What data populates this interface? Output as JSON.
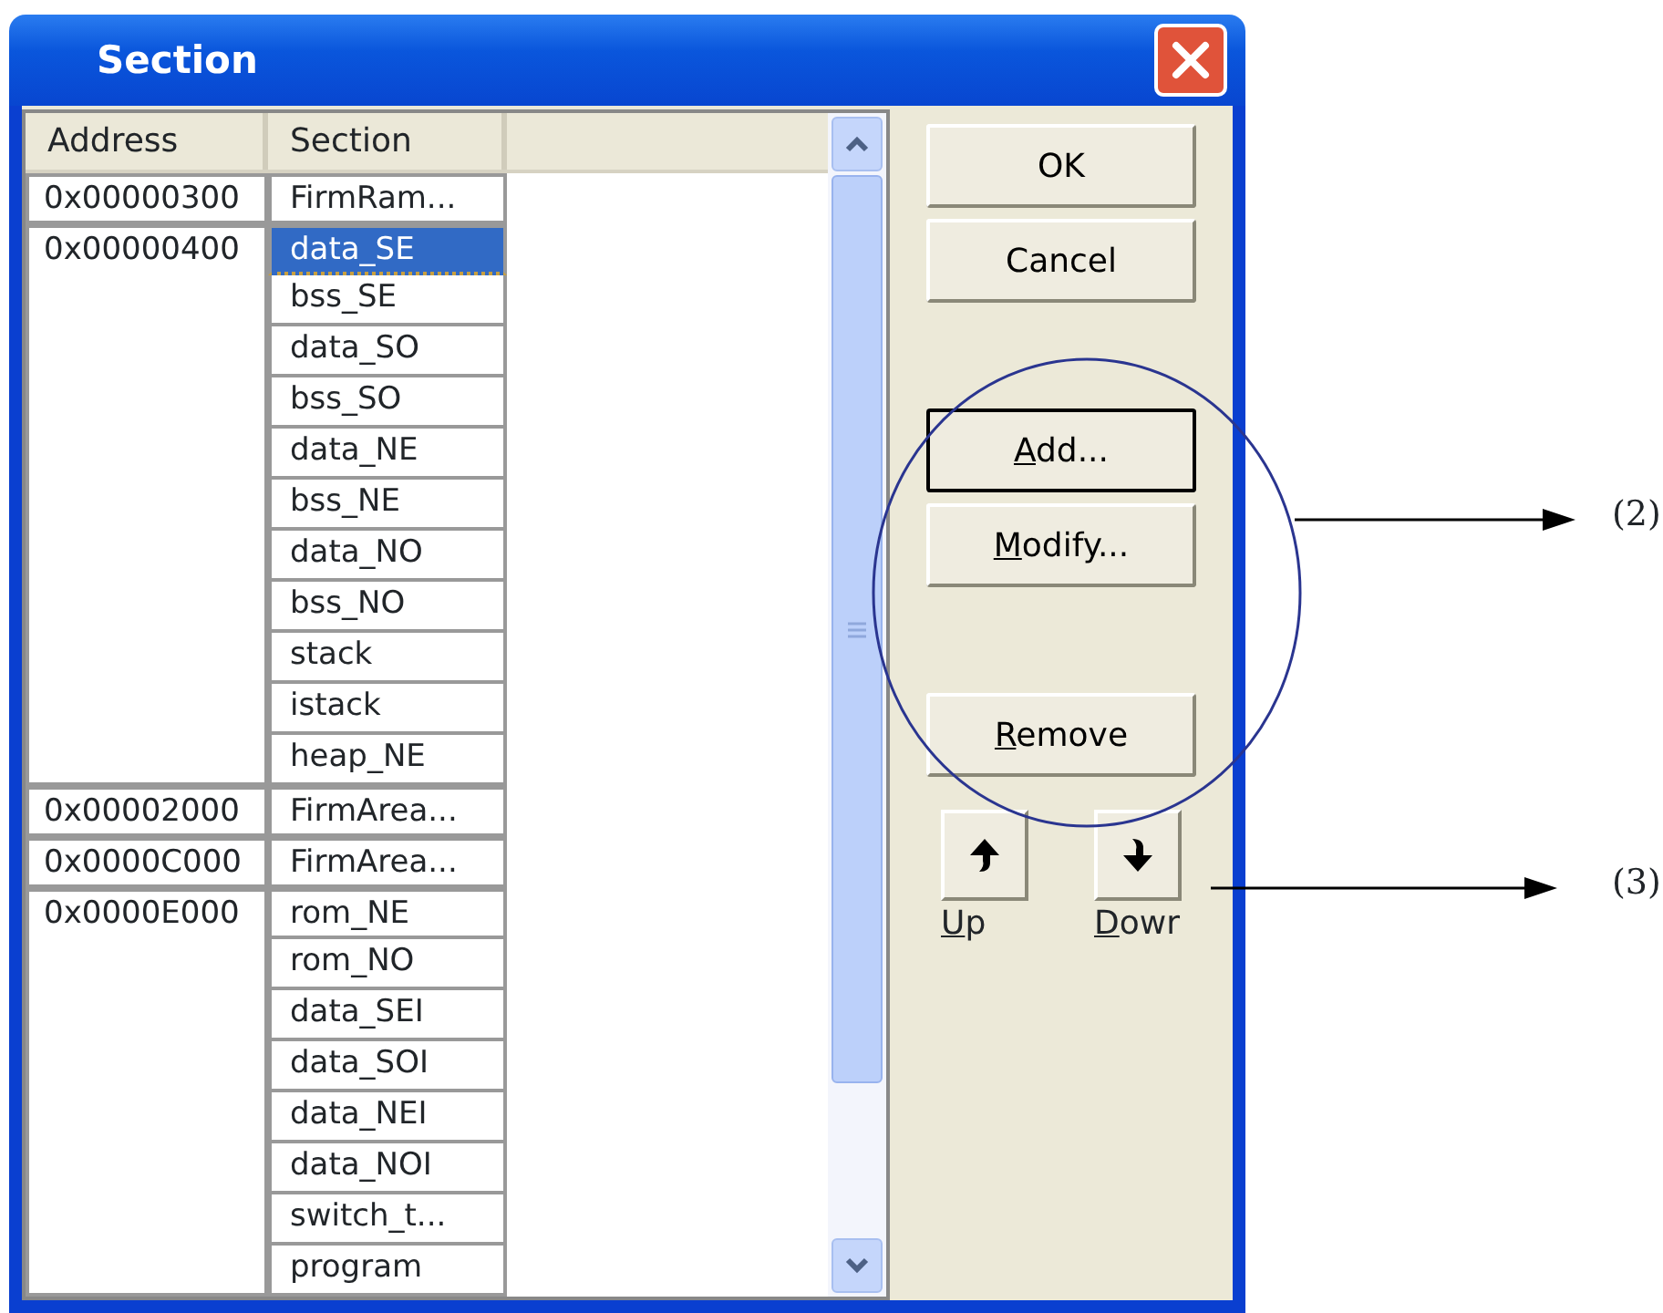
{
  "window": {
    "title": "Section"
  },
  "table": {
    "columns": [
      "Address",
      "Section"
    ],
    "groups": [
      {
        "address": "0x00000300",
        "sections": [
          {
            "name": "FirmRam...",
            "selected": false
          }
        ]
      },
      {
        "address": "0x00000400",
        "sections": [
          {
            "name": "data_SE",
            "selected": true
          },
          {
            "name": "bss_SE",
            "selected": false
          },
          {
            "name": "data_SO",
            "selected": false
          },
          {
            "name": "bss_SO",
            "selected": false
          },
          {
            "name": "data_NE",
            "selected": false
          },
          {
            "name": "bss_NE",
            "selected": false
          },
          {
            "name": "data_NO",
            "selected": false
          },
          {
            "name": "bss_NO",
            "selected": false
          },
          {
            "name": "stack",
            "selected": false
          },
          {
            "name": "istack",
            "selected": false
          },
          {
            "name": "heap_NE",
            "selected": false
          }
        ]
      },
      {
        "address": "0x00002000",
        "sections": [
          {
            "name": "FirmArea...",
            "selected": false
          }
        ]
      },
      {
        "address": "0x0000C000",
        "sections": [
          {
            "name": "FirmArea...",
            "selected": false
          }
        ]
      },
      {
        "address": "0x0000E000",
        "sections": [
          {
            "name": "rom_NE",
            "selected": false
          },
          {
            "name": "rom_NO",
            "selected": false
          },
          {
            "name": "data_SEI",
            "selected": false
          },
          {
            "name": "data_SOI",
            "selected": false
          },
          {
            "name": "data_NEI",
            "selected": false
          },
          {
            "name": "data_NOI",
            "selected": false
          },
          {
            "name": "switch_t...",
            "selected": false
          },
          {
            "name": "program",
            "selected": false
          }
        ]
      }
    ]
  },
  "button_groups": [
    [
      {
        "label": "OK",
        "default": false,
        "mnemonic": false
      },
      {
        "label": "Cancel",
        "default": false,
        "mnemonic": false
      }
    ],
    [
      {
        "label": "Add...",
        "default": true,
        "mnemonic": true
      },
      {
        "label": "Modify...",
        "default": false,
        "mnemonic": true
      }
    ],
    [
      {
        "label": "Remove",
        "default": false,
        "mnemonic": true
      }
    ]
  ],
  "move_buttons": [
    {
      "label": "Up",
      "kind": "up",
      "mnemonic": true
    },
    {
      "label": "Dowr",
      "kind": "down",
      "mnemonic": true
    }
  ],
  "annotations": [
    {
      "label": "(2)"
    },
    {
      "label": "(3)"
    }
  ]
}
